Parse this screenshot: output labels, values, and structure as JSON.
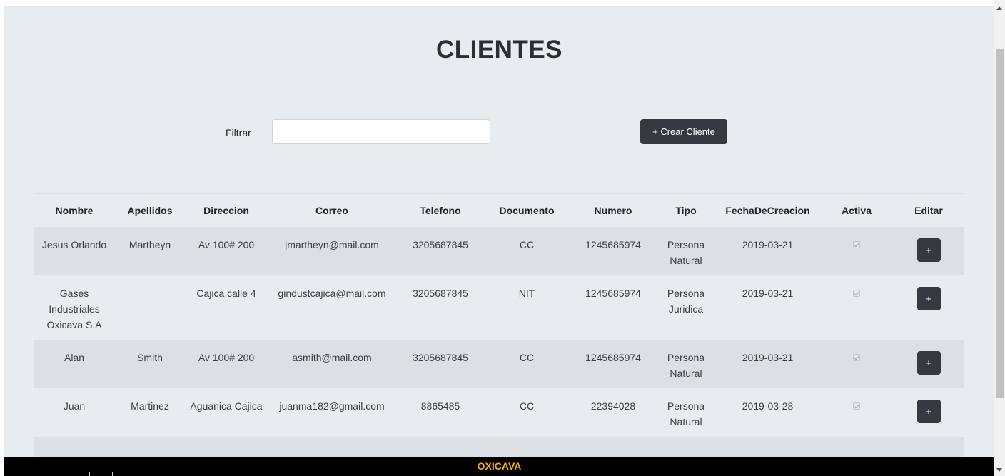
{
  "page": {
    "title": "CLIENTES"
  },
  "filter": {
    "label": "Filtrar",
    "value": "",
    "placeholder": ""
  },
  "toolbar": {
    "create_label": "+ Crear Cliente"
  },
  "table": {
    "headers": [
      "Nombre",
      "Apellidos",
      "Direccion",
      "Correo",
      "Telefono",
      "Documento",
      "Numero",
      "Tipo",
      "FechaDeCreacion",
      "Activa",
      "Editar"
    ],
    "rows": [
      {
        "nombre": "Jesus Orlando",
        "apellidos": "Martheyn",
        "direccion": "Av 100# 200",
        "correo": "jmartheyn@mail.com",
        "telefono": "3205687845",
        "documento": "CC",
        "numero": "1245685974",
        "tipo": "Persona Natural",
        "fecha": "2019-03-21",
        "activa": true,
        "editar": "+"
      },
      {
        "nombre": "Gases Industriales Oxicava S.A",
        "apellidos": "",
        "direccion": "Cajica calle 4",
        "correo": "gindustcajica@mail.com",
        "telefono": "3205687845",
        "documento": "NIT",
        "numero": "1245685974",
        "tipo": "Persona Juridica",
        "fecha": "2019-03-21",
        "activa": true,
        "editar": "+"
      },
      {
        "nombre": "Alan",
        "apellidos": "Smith",
        "direccion": "Av 100# 200",
        "correo": "asmith@mail.com",
        "telefono": "3205687845",
        "documento": "CC",
        "numero": "1245685974",
        "tipo": "Persona Natural",
        "fecha": "2019-03-21",
        "activa": true,
        "editar": "+"
      },
      {
        "nombre": "Juan",
        "apellidos": "Martinez",
        "direccion": "Aguanica Cajica",
        "correo": "juanma182@gmail.com",
        "telefono": "8865485",
        "documento": "CC",
        "numero": "22394028",
        "tipo": "Persona Natural",
        "fecha": "2019-03-28",
        "activa": true,
        "editar": "+"
      }
    ]
  },
  "footer": {
    "brand": "OXICAVA"
  },
  "colors": {
    "background": "#e9ecef",
    "dark_button": "#343a40",
    "footer_bg": "#000000",
    "brand": "#f5b400",
    "stripe": "#dcdfe3"
  },
  "icons": {
    "activa": "checkbox-checked-icon",
    "scroll_up": "scroll-up-arrow-icon",
    "scroll_down": "scroll-down-arrow-icon"
  }
}
